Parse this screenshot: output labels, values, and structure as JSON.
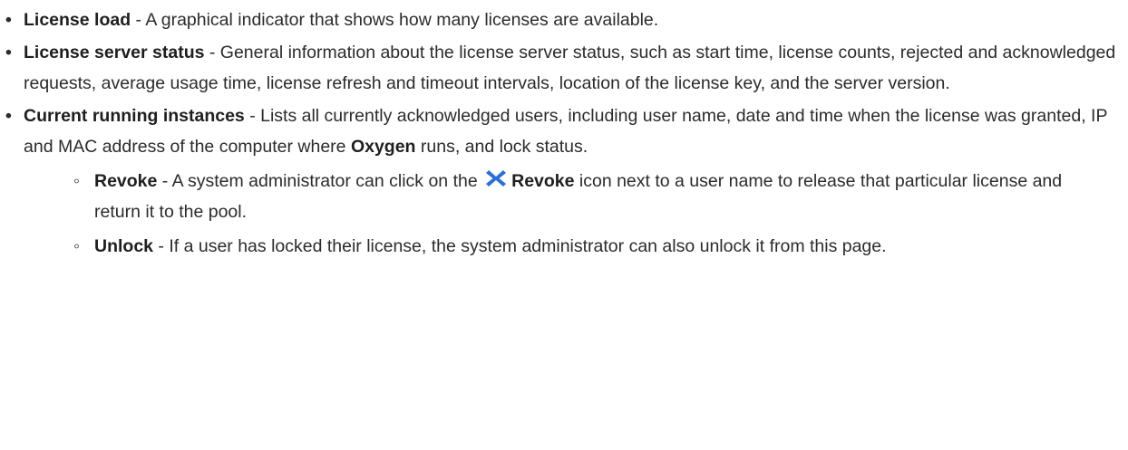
{
  "items": [
    {
      "term": "License load",
      "description": " - A graphical indicator that shows how many licenses are available."
    },
    {
      "term": "License server status",
      "description": " - General information about the license server status, such as start time, license counts, rejected and acknowledged requests, average usage time, license refresh and timeout intervals, location of the license key, and the server version."
    },
    {
      "term": "Current running instances",
      "description_before": " - Lists all currently acknowledged users, including user name, date and time when the license was granted, IP and MAC address of the computer where ",
      "product": "Oxygen",
      "description_after": " runs, and lock status.",
      "subitems": [
        {
          "term": "Revoke",
          "text_before_icon": " - A system administrator can click on the ",
          "icon": "revoke-x-icon",
          "icon_color": "#2a6fd6",
          "icon_label": "Revoke",
          "text_after_icon": " icon next to a user name to release that particular license and return it to the pool."
        },
        {
          "term": "Unlock",
          "description": " - If a user has locked their license, the system administrator can also unlock it from this page."
        }
      ]
    }
  ]
}
